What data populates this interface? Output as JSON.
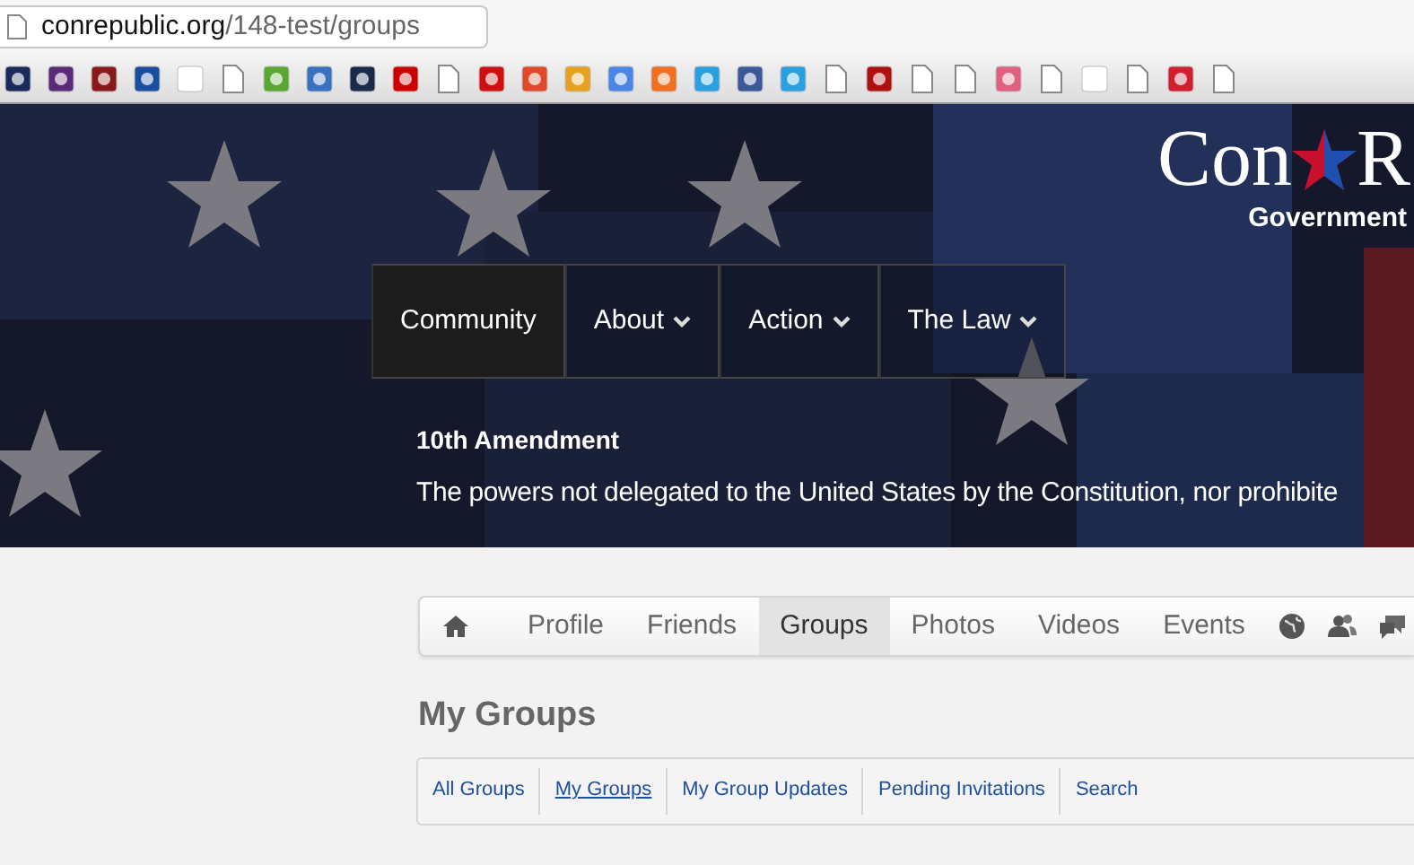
{
  "browser": {
    "url_domain": "conrepublic.org",
    "url_path": "/148-test/groups"
  },
  "site": {
    "logo_left": "Con",
    "logo_right": "R",
    "tagline": "Government"
  },
  "main_nav": [
    {
      "label": "Community",
      "selected": true,
      "has_menu": false
    },
    {
      "label": "About",
      "selected": false,
      "has_menu": true
    },
    {
      "label": "Action",
      "selected": false,
      "has_menu": true
    },
    {
      "label": "The Law",
      "selected": false,
      "has_menu": true
    }
  ],
  "quote": {
    "title": "10th Amendment",
    "text": "The powers not delegated to the United States by the Constitution, nor prohibite"
  },
  "profile_tabs": [
    {
      "kind": "home",
      "selected": false
    },
    {
      "kind": "text",
      "label": "Profile",
      "selected": false
    },
    {
      "kind": "text",
      "label": "Friends",
      "selected": false
    },
    {
      "kind": "text",
      "label": "Groups",
      "selected": true
    },
    {
      "kind": "text",
      "label": "Photos",
      "selected": false
    },
    {
      "kind": "text",
      "label": "Videos",
      "selected": false
    },
    {
      "kind": "text",
      "label": "Events",
      "selected": false
    },
    {
      "kind": "globe",
      "selected": false
    },
    {
      "kind": "people",
      "selected": false
    },
    {
      "kind": "chat",
      "selected": false
    }
  ],
  "heading": "My Groups",
  "group_links": [
    {
      "label": "All Groups",
      "selected": false
    },
    {
      "label": "My Groups",
      "selected": true
    },
    {
      "label": "My Group Updates",
      "selected": false
    },
    {
      "label": "Pending Invitations",
      "selected": false
    },
    {
      "label": "Search",
      "selected": false
    }
  ]
}
